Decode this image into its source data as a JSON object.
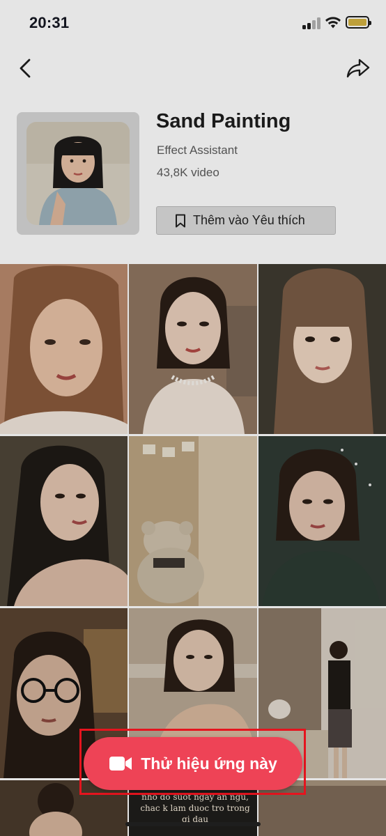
{
  "status_bar": {
    "time": "20:31",
    "signal_icon": "signal-bars-icon",
    "wifi_icon": "wifi-icon",
    "battery_icon": "battery-icon",
    "battery_color": "#d4b342"
  },
  "nav": {
    "back_icon": "chevron-left-icon",
    "share_icon": "share-arrow-icon"
  },
  "effect": {
    "title": "Sand Painting",
    "author": "Effect Assistant",
    "video_count": "43,8K video",
    "favorite_label": "Thêm vào Yêu thích",
    "favorite_icon": "bookmark-icon"
  },
  "videos": [
    {
      "subject": "portrait",
      "tone": "#b98a6c"
    },
    {
      "subject": "portrait",
      "tone": "#8f7560"
    },
    {
      "subject": "portrait",
      "tone": "#7a5c46"
    },
    {
      "subject": "portrait",
      "tone": "#4e4638"
    },
    {
      "subject": "teddy bear wall",
      "tone": "#bca482"
    },
    {
      "subject": "portrait",
      "tone": "#2f3a34"
    },
    {
      "subject": "portrait with glasses",
      "tone": "#5a4330"
    },
    {
      "subject": "portrait",
      "tone": "#b8a894"
    },
    {
      "subject": "room",
      "tone": "#8a7866"
    },
    {
      "subject": "portrait",
      "tone": "#4a3a2c"
    },
    {
      "subject": "caption",
      "tone": "#1f1d1b",
      "caption": "nho do suot ngay an ngu, chac k lam duoc tro trong gi dau"
    },
    {
      "subject": "room",
      "tone": "#7e6a58"
    }
  ],
  "cta": {
    "label": "Thử hiệu ứng này",
    "icon": "video-camera-icon",
    "color": "#ee4356",
    "highlight_color": "#e5141e"
  }
}
